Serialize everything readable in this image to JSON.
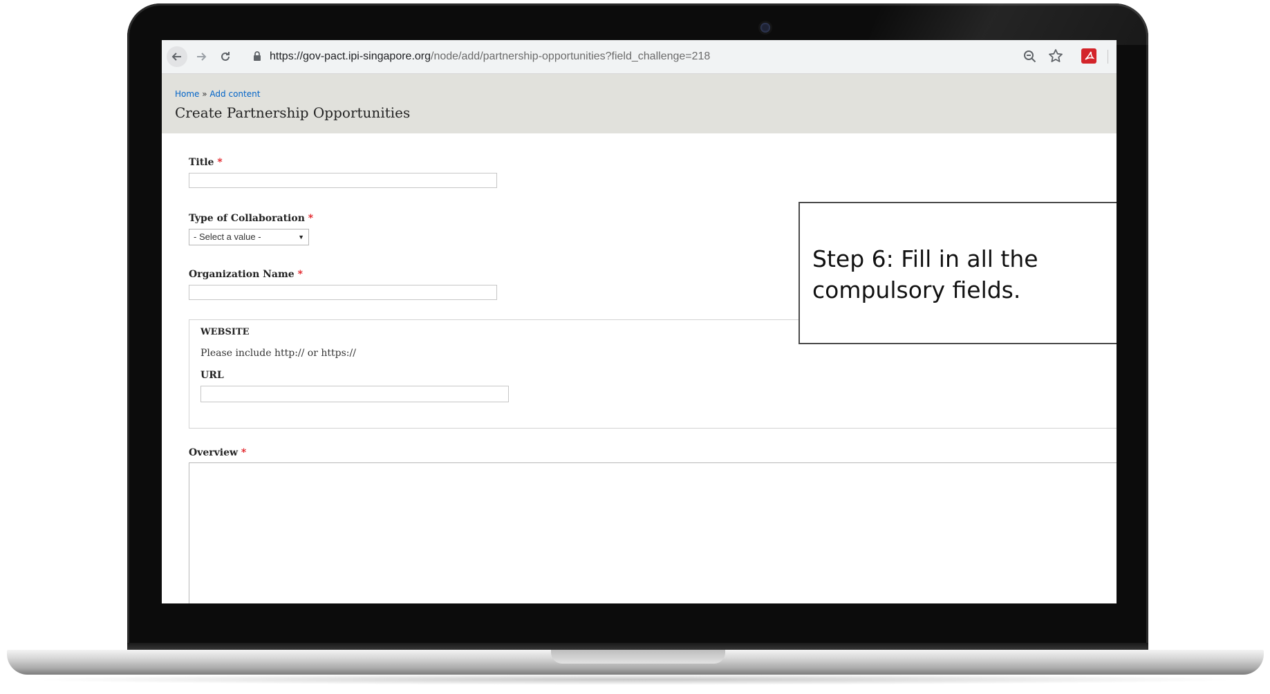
{
  "browser": {
    "url_host": "https://gov-pact.ipi-singapore.org",
    "url_path": "/node/add/partnership-opportunities?field_challenge=218"
  },
  "breadcrumb": {
    "home": "Home",
    "separator": " » ",
    "add_content": "Add content"
  },
  "page": {
    "title": "Create Partnership Opportunities"
  },
  "form": {
    "required_marker": "*",
    "title_label": "Title",
    "collaboration_label": "Type of Collaboration",
    "collaboration_value": "- Select a value -",
    "organization_label": "Organization Name",
    "website": {
      "legend": "WEBSITE",
      "hint": "Please include http:// or https://",
      "url_label": "URL"
    },
    "overview_label": "Overview"
  },
  "annotation": {
    "text": "Step 6: Fill in all the compulsory fields."
  },
  "icons": {
    "back": "back-arrow-icon",
    "forward": "forward-arrow-icon",
    "reload": "reload-icon",
    "lock": "lock-icon",
    "zoom": "zoom-out-icon",
    "bookmark": "star-icon",
    "extension": "pdf-extension-icon"
  },
  "colors": {
    "required": "#e0151b",
    "link": "#0063c7",
    "header_bg": "#e1e1dc"
  }
}
